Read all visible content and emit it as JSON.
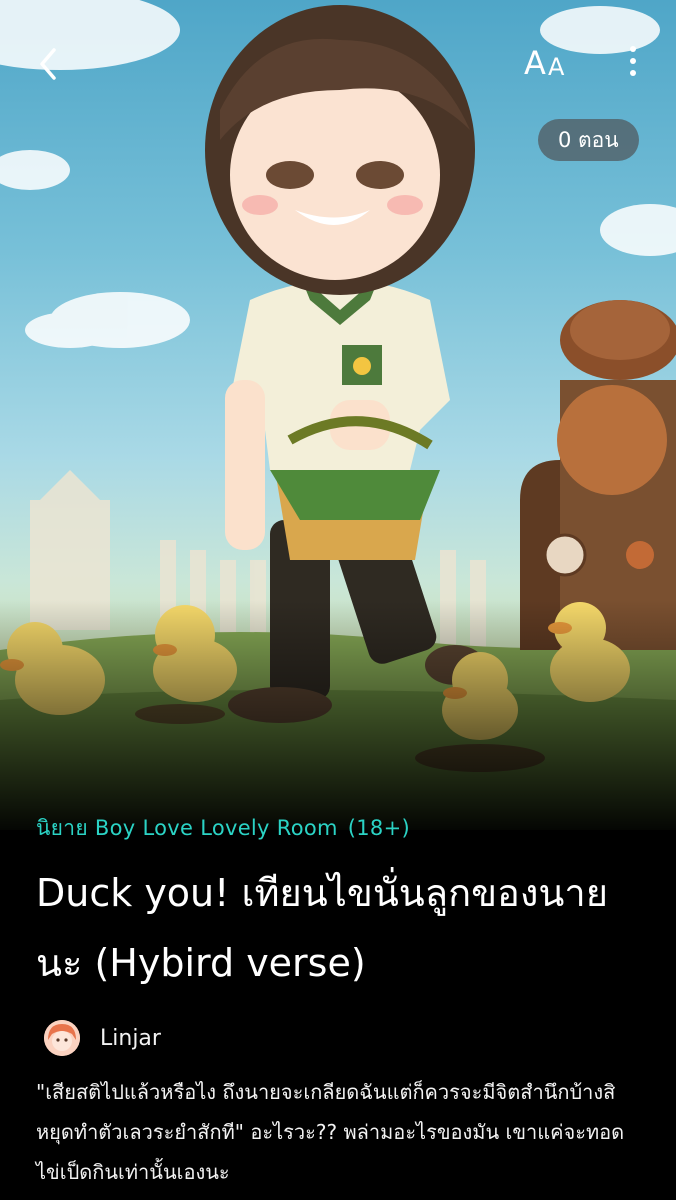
{
  "header": {
    "back_icon": "chevron-left-icon",
    "font_size_label": "A",
    "more_icon": "more-vertical-icon",
    "episode_badge": "0 ตอน"
  },
  "cover": {
    "description": "chibi boy with basket walking among ducklings"
  },
  "novel": {
    "category": "นิยาย Boy Love Lovely Room",
    "age_rating": "(18+)",
    "title": "Duck you! เทียนไขนั่นลูกของนายนะ (Hybird verse)",
    "author": "Linjar",
    "synopsis": "\"เสียสติไปแล้วหรือไง ถึงนายจะเกลียดฉันแต่ก็ควรจะมีจิตสำนึกบ้างสิ หยุดทำตัวเลวระยำสักที\" อะไรวะ?? พล่ามอะไรของมัน เขาแค่จะทอดไข่เป็ดกินเท่านั้นเองนะ"
  },
  "colors": {
    "accent": "#2bd3c5",
    "background": "#000000",
    "badge_bg": "#505a5f"
  }
}
